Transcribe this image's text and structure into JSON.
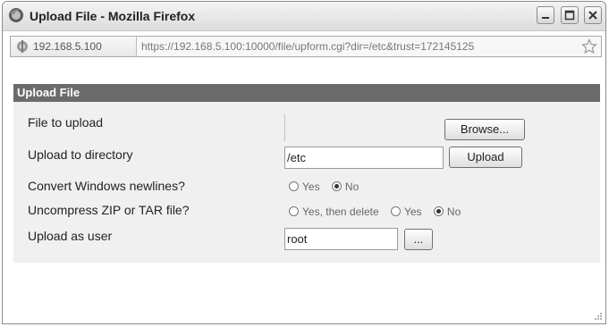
{
  "window": {
    "title": "Upload File - Mozilla Firefox"
  },
  "urlbar": {
    "site": "192.168.5.100",
    "url": "https://192.168.5.100:10000/file/upform.cgi?dir=/etc&trust=172145125"
  },
  "form": {
    "section_title": "Upload File",
    "file_label": "File to upload",
    "browse_label": "Browse...",
    "directory_label": "Upload to directory",
    "directory_value": "/etc",
    "upload_label": "Upload",
    "convert_label": "Convert Windows newlines?",
    "convert_options": [
      "Yes",
      "No"
    ],
    "convert_selected": "No",
    "uncompress_label": "Uncompress ZIP or TAR file?",
    "uncompress_options": [
      "Yes, then delete",
      "Yes",
      "No"
    ],
    "uncompress_selected": "No",
    "user_label": "Upload as user",
    "user_value": "root",
    "user_picker_label": "..."
  },
  "icons": {
    "app": "firefox-icon",
    "site": "site-identity-icon",
    "bookmark": "star-icon",
    "minimize": "minimize-icon",
    "maximize": "maximize-icon",
    "close": "close-icon",
    "resize": "resize-grip-icon"
  }
}
